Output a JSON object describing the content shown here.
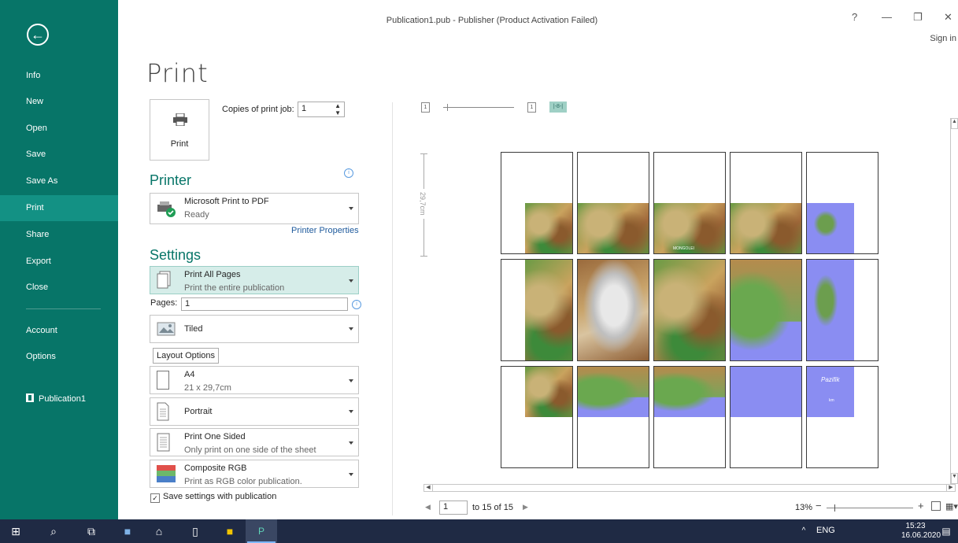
{
  "window": {
    "title": "Publication1.pub - Publisher (Product Activation Failed)",
    "help": "?",
    "minimize": "—",
    "restore": "❐",
    "close": "✕",
    "sign_in": "Sign in"
  },
  "sidebar": {
    "back": "←",
    "items": [
      "Info",
      "New",
      "Open",
      "Save",
      "Save As",
      "Print",
      "Share",
      "Export",
      "Close",
      "Account",
      "Options"
    ],
    "active": "Print",
    "recent": "Publication1"
  },
  "page_title": "Print",
  "print_button": {
    "label": "Print"
  },
  "copies": {
    "label": "Copies of print job:",
    "value": "1"
  },
  "printer": {
    "heading": "Printer",
    "name": "Microsoft Print to PDF",
    "status": "Ready",
    "properties_link": "Printer Properties"
  },
  "settings": {
    "heading": "Settings",
    "range": {
      "title": "Print All Pages",
      "subtitle": "Print the entire publication"
    },
    "pages": {
      "label": "Pages:",
      "value": "1"
    },
    "layout": {
      "title": "Tiled"
    },
    "layout_options": "Layout Options",
    "paper": {
      "title": "A4",
      "subtitle": "21 x 29,7cm"
    },
    "orientation": {
      "title": "Portrait"
    },
    "sides": {
      "title": "Print One Sided",
      "subtitle": "Only print on one side of the sheet"
    },
    "color": {
      "title": "Composite RGB",
      "subtitle": "Print as RGB color publication."
    },
    "save_settings": "Save settings with publication"
  },
  "preview": {
    "ruler_label": "29,7cm",
    "single_page_icon": "1",
    "page_icon_2": "1",
    "multi_page_icon": "|-8-|",
    "tile_labels": {
      "mongolei": "MONGOLEI",
      "pazifik": "Pazifik",
      "km": "km"
    },
    "page_current": "1",
    "page_total_text": "to 15 of 15",
    "zoom": "13%"
  },
  "taskbar": {
    "language": "ENG",
    "time": "15:23",
    "date": "16.06.2020"
  },
  "colors": {
    "accent": "#077568",
    "accent_active": "#139184",
    "taskbar": "#1f2a44",
    "sea": "#8a8df2"
  }
}
